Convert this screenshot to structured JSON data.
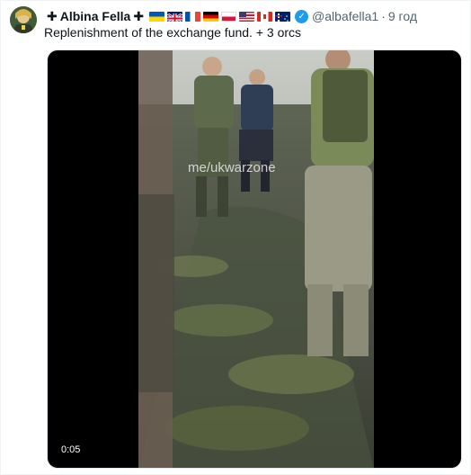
{
  "tweet": {
    "display_name": "Albina Fella",
    "cross_left": "✚",
    "cross_right": "✚",
    "flags": [
      "ukraine-flag",
      "uk-flag",
      "france-flag",
      "germany-flag",
      "poland-flag",
      "usa-flag",
      "canada-flag",
      "australia-flag"
    ],
    "handle": "@albafella1",
    "separator": "·",
    "time": "9 год",
    "text": "Replenishment of the exchange fund. + 3 orcs",
    "verified_mark": "✓"
  },
  "media": {
    "type": "video",
    "watermark": "me/ukwarzone",
    "duration": "0:05"
  }
}
